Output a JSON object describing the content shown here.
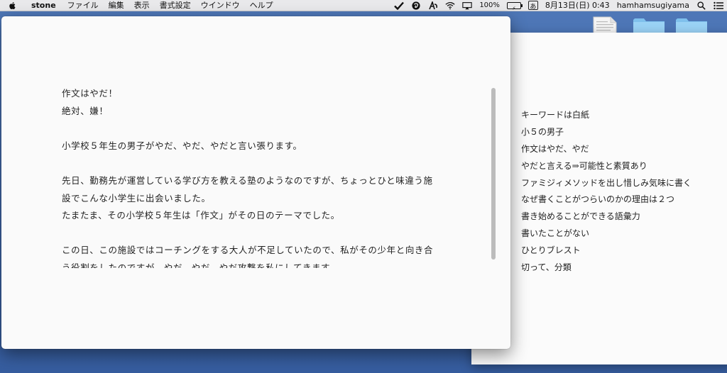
{
  "menubar": {
    "app_name": "stone",
    "menus": [
      "ファイル",
      "編集",
      "表示",
      "書式設定",
      "ウインドウ",
      "ヘルプ"
    ],
    "status_icons": [
      "checkmark-icon",
      "evernote-icon",
      "script-icon",
      "wifi-icon",
      "airplay-icon"
    ],
    "battery": "100%",
    "battery_box": "⚡",
    "input_method": "あ",
    "datetime": "8月13日(日) 0:43",
    "username": "hamhamsugiyama"
  },
  "editor": {
    "paragraphs": [
      "作文はやだ！",
      "絶対、嫌！",
      "",
      "小学校５年生の男子がやだ、やだ、やだと言い張ります。",
      "",
      "先日、勤務先が運営している学び方を教える塾のようなのですが、ちょっとひと味違う施",
      "設でこんな小学生に出会いました。",
      "たまたま、その小学校５年生は「作文」がその日のテーマでした。",
      "",
      "この日、この施設ではコーチングをする大人が不足していたので、私がその少年と向き合",
      "う役割をしたのですが、やだ、やだ、やだ攻撃を私にしてきます。"
    ]
  },
  "outline": {
    "items": [
      "キーワードは白紙",
      "小５の男子",
      "作文はやだ、やだ",
      "やだと言える⇒可能性と素質あり",
      "ファミジィメソッドを出し惜しみ気味に書く",
      "なぜ書くことがつらいのかの理由は２つ",
      "書き始めることができる語彙力",
      "書いたことがない",
      "ひとりブレスト",
      "切って、分類"
    ]
  }
}
